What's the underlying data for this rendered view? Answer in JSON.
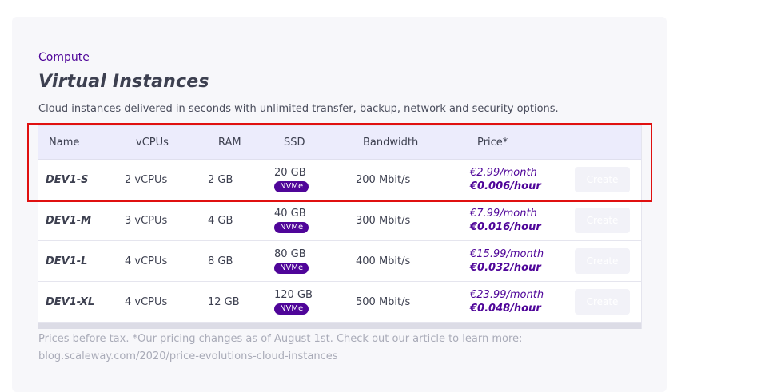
{
  "header": {
    "category": "Compute",
    "title": "Virtual Instances",
    "description": "Cloud instances delivered in seconds with unlimited transfer, backup, network and security options."
  },
  "table": {
    "columns": {
      "name": "Name",
      "vcpus": "vCPUs",
      "ram": "RAM",
      "ssd": "SSD",
      "bandwidth": "Bandwidth",
      "price": "Price*"
    },
    "rows": [
      {
        "name": "DEV1-S",
        "vcpus": "2 vCPUs",
        "ram": "2 GB",
        "ssd": "20 GB",
        "ssd_type": "NVMe",
        "bandwidth": "200 Mbit/s",
        "price_month": "€2.99/month",
        "price_hour": "€0.006/hour",
        "action": "Create"
      },
      {
        "name": "DEV1-M",
        "vcpus": "3 vCPUs",
        "ram": "4 GB",
        "ssd": "40 GB",
        "ssd_type": "NVMe",
        "bandwidth": "300 Mbit/s",
        "price_month": "€7.99/month",
        "price_hour": "€0.016/hour",
        "action": "Create"
      },
      {
        "name": "DEV1-L",
        "vcpus": "4 vCPUs",
        "ram": "8 GB",
        "ssd": "80 GB",
        "ssd_type": "NVMe",
        "bandwidth": "400 Mbit/s",
        "price_month": "€15.99/month",
        "price_hour": "€0.032/hour",
        "action": "Create"
      },
      {
        "name": "DEV1-XL",
        "vcpus": "4 vCPUs",
        "ram": "12 GB",
        "ssd": "120 GB",
        "ssd_type": "NVMe",
        "bandwidth": "500 Mbit/s",
        "price_month": "€23.99/month",
        "price_hour": "€0.048/hour",
        "action": "Create"
      }
    ]
  },
  "footer": {
    "note_line1": "Prices before tax. *Our pricing changes as of August 1st. Check out our article to learn more:",
    "note_line2": "blog.scaleway.com/2020/price-evolutions-cloud-instances"
  },
  "colors": {
    "accent": "#4f0599",
    "highlight": "#e01010",
    "header_bg": "#ececfc"
  }
}
